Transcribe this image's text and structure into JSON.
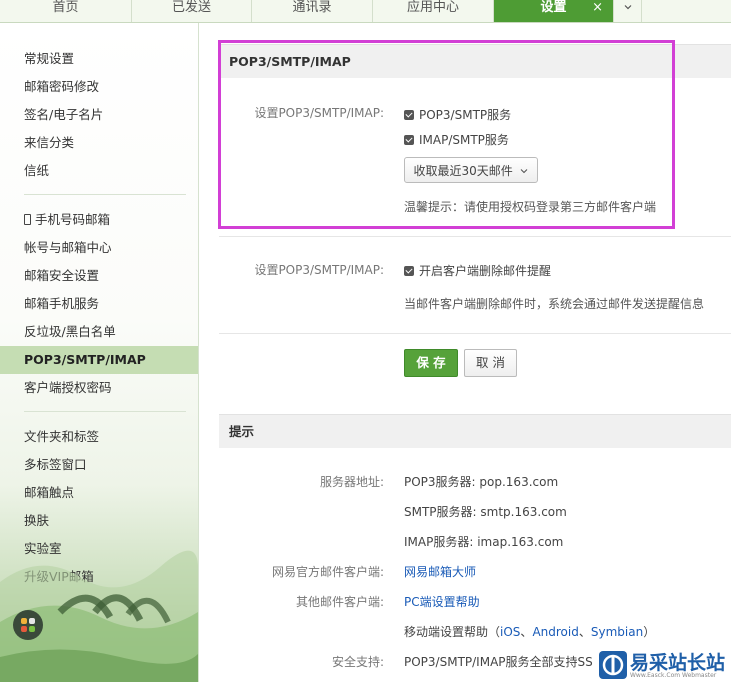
{
  "topnav": {
    "tabs": [
      {
        "label": "首页"
      },
      {
        "label": "已发送"
      },
      {
        "label": "通讯录"
      },
      {
        "label": "应用中心"
      },
      {
        "label": "设置",
        "close": "×"
      }
    ]
  },
  "sidebar": {
    "group1": [
      "常规设置",
      "邮箱密码修改",
      "签名/电子名片",
      "来信分类",
      "信纸"
    ],
    "group2": [
      "手机号码邮箱",
      "帐号与邮箱中心",
      "邮箱安全设置",
      "邮箱手机服务",
      "反垃圾/黑白名单",
      "POP3/SMTP/IMAP",
      "客户端授权密码"
    ],
    "group3": [
      "文件夹和标签",
      "多标签窗口",
      "邮箱触点",
      "换肤",
      "实验室",
      "升级VIP邮箱"
    ]
  },
  "pop3_panel": {
    "title": "POP3/SMTP/IMAP",
    "label1": "设置POP3/SMTP/IMAP:",
    "pop3_smtp_service": "POP3/SMTP服务",
    "imap_smtp_service": "IMAP/SMTP服务",
    "recent_select": "收取最近30天邮件",
    "tip": "温馨提示：请使用授权码登录第三方邮件客户端",
    "label2": "设置POP3/SMTP/IMAP:",
    "delete_reminder": "开启客户端删除邮件提醒",
    "delete_reminder_desc": "当邮件客户端删除邮件时，系统会通过邮件发送提醒信息",
    "save": "保 存",
    "cancel": "取 消"
  },
  "tips_panel": {
    "title": "提示",
    "server_label": "服务器地址:",
    "pop3_server": "POP3服务器: pop.163.com",
    "smtp_server": "SMTP服务器: smtp.163.com",
    "imap_server": "IMAP服务器: imap.163.com",
    "official_client_label": "网易官方邮件客户端:",
    "official_client_link": "网易邮箱大师",
    "other_client_label": "其他邮件客户端:",
    "pc_help_link": "PC端设置帮助",
    "mobile_help_prefix": "移动端设置帮助（",
    "mobile_ios": "iOS",
    "sep1": "、",
    "mobile_android": "Android",
    "sep2": "、",
    "mobile_symbian": "Symbian",
    "mobile_help_suffix": "）",
    "security_label": "安全支持:",
    "security_value": "POP3/SMTP/IMAP服务全部支持SS"
  },
  "watermark": {
    "text": "易采站长站",
    "sub": "Www.Easck.Com Webmaster"
  },
  "colors": {
    "accent_green": "#4e9c34",
    "highlight_magenta": "#d23fd5",
    "link_blue": "#1a5bb7"
  }
}
